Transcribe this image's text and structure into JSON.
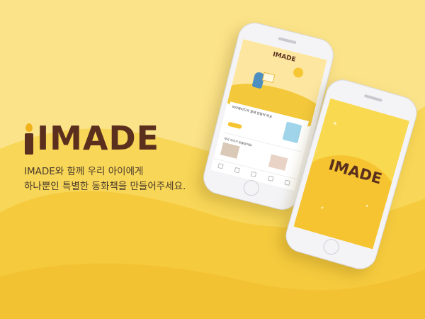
{
  "brand": {
    "logo_text": "IMADE",
    "tagline_lines": [
      "IMADE와 함께 우리 아이에게",
      "하나뿐인 특별한 동화책을 만들어주세요."
    ]
  },
  "colors": {
    "background": "#fbe38a",
    "wave": "#f6cd3b",
    "logo_brown": "#5a2f1e",
    "flame": "#f2b21c"
  },
  "phone_left": {
    "header_logo": "IMADE",
    "card1_title": "아이메이드와 함께 만들어 봐요",
    "card2_title": "우리 아이가 만들었어요!",
    "tabs": [
      "",
      "",
      "",
      "",
      ""
    ]
  },
  "phone_right": {
    "splash_logo": "IMADE"
  }
}
